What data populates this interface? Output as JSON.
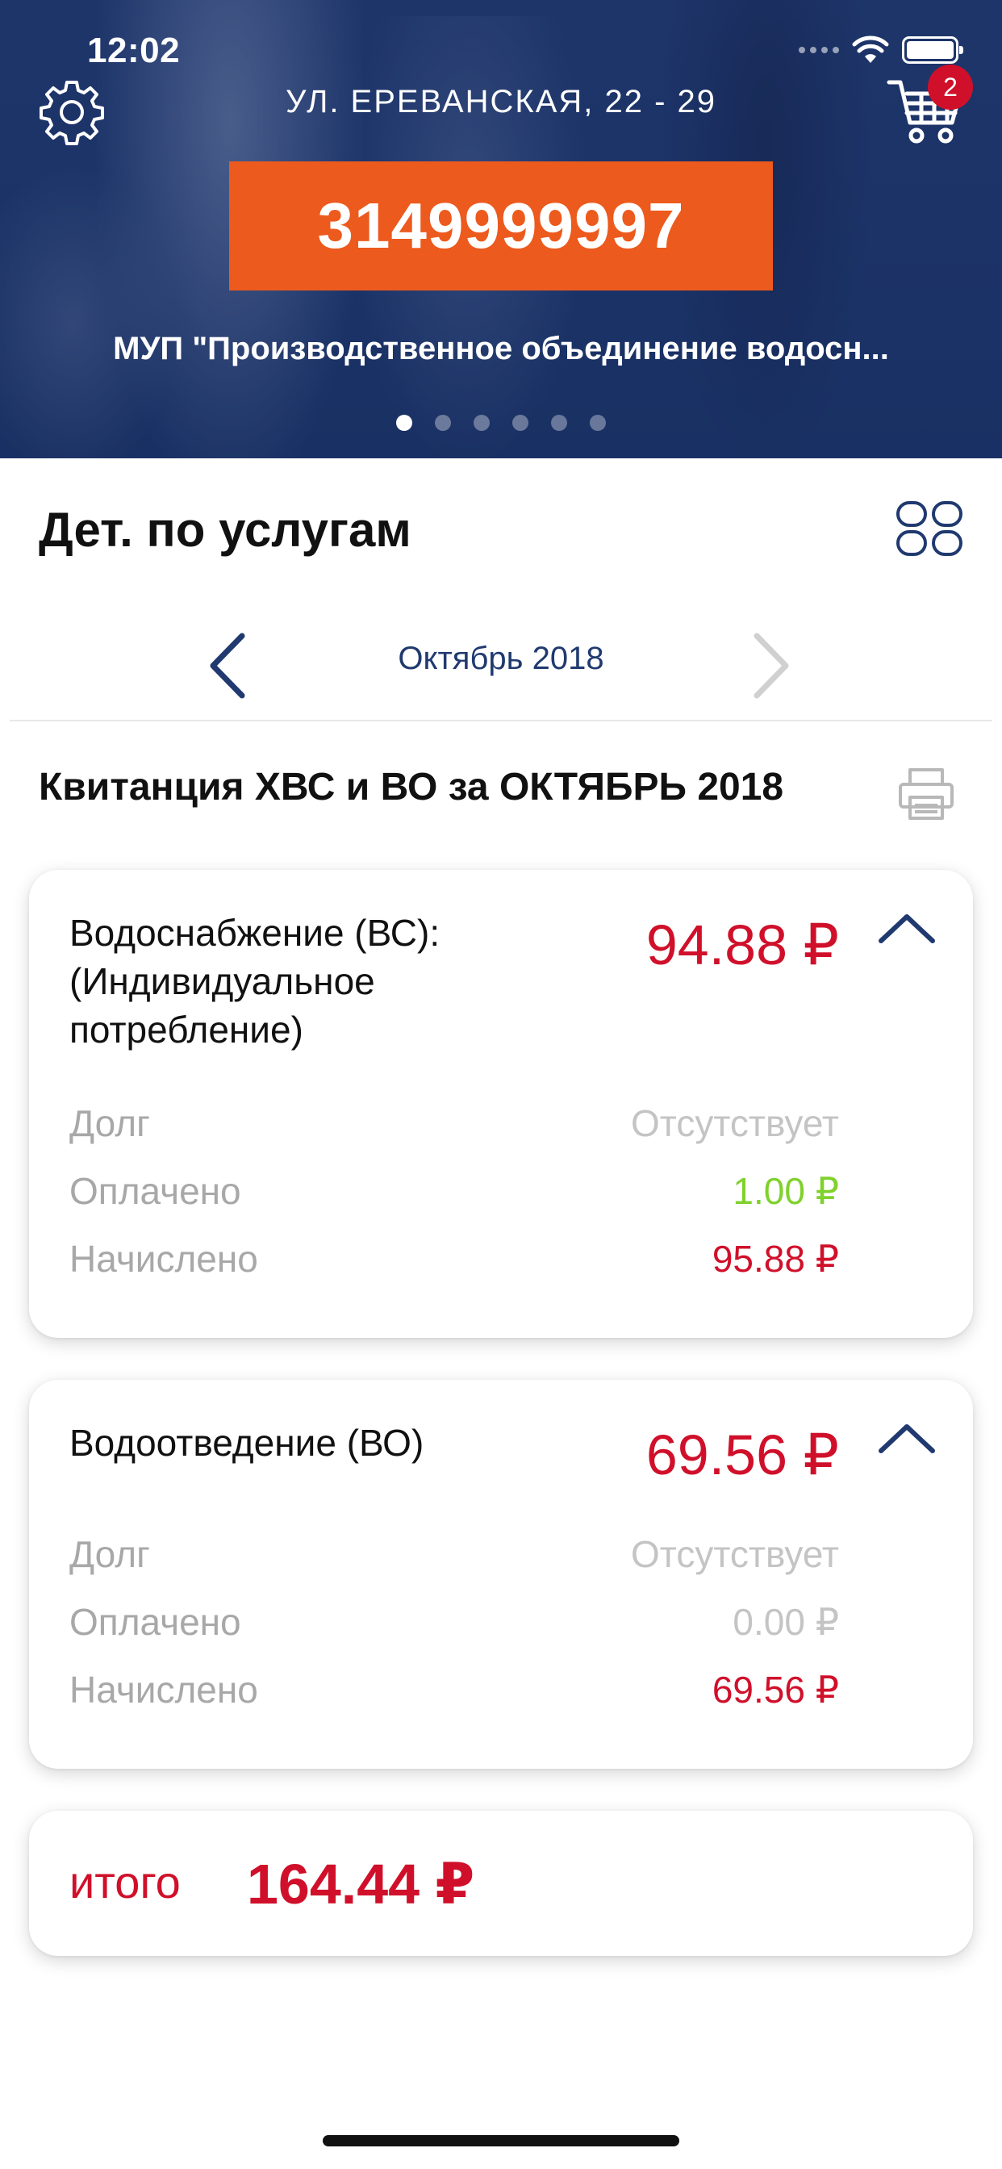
{
  "status_bar": {
    "time": "12:02"
  },
  "header": {
    "address": "УЛ. ЕРЕВАНСКАЯ, 22 - 29",
    "cart_badge": "2",
    "account_number": "3149999997",
    "company": "МУП \"Производственное объединение водосн...",
    "pager": {
      "total": 6,
      "active_index": 0
    }
  },
  "section": {
    "title": "Дет. по услугам",
    "month": "Октябрь 2018",
    "receipt_title": "Квитанция ХВС и ВО за ОКТЯБРЬ 2018"
  },
  "services": [
    {
      "name": "Водоснабжение (ВС): (Индивидуальное потребление)",
      "amount": "94.88 ₽",
      "rows": [
        {
          "label": "Долг",
          "value": "Отсутствует"
        },
        {
          "label": "Оплачено",
          "value": "1.00 ₽"
        },
        {
          "label": "Начислено",
          "value": "95.88 ₽"
        }
      ]
    },
    {
      "name": "Водоотведение (ВО)",
      "amount": "69.56 ₽",
      "rows": [
        {
          "label": "Долг",
          "value": "Отсутствует"
        },
        {
          "label": "Оплачено",
          "value": "0.00 ₽"
        },
        {
          "label": "Начислено",
          "value": "69.56 ₽"
        }
      ]
    }
  ],
  "total": {
    "label": "итого",
    "value": "164.44 ₽"
  },
  "colors": {
    "accent_red": "#d0102a",
    "account_orange": "#ec5a1d",
    "nav_blue": "#203a70",
    "paid_green": "#80d12d",
    "muted_gray": "#a8a8a8"
  },
  "icons": [
    "gear-icon",
    "cart-icon",
    "grid-icon",
    "chevron-left-icon",
    "chevron-right-icon",
    "printer-icon",
    "chevron-up-icon",
    "wifi-icon",
    "battery-icon"
  ]
}
